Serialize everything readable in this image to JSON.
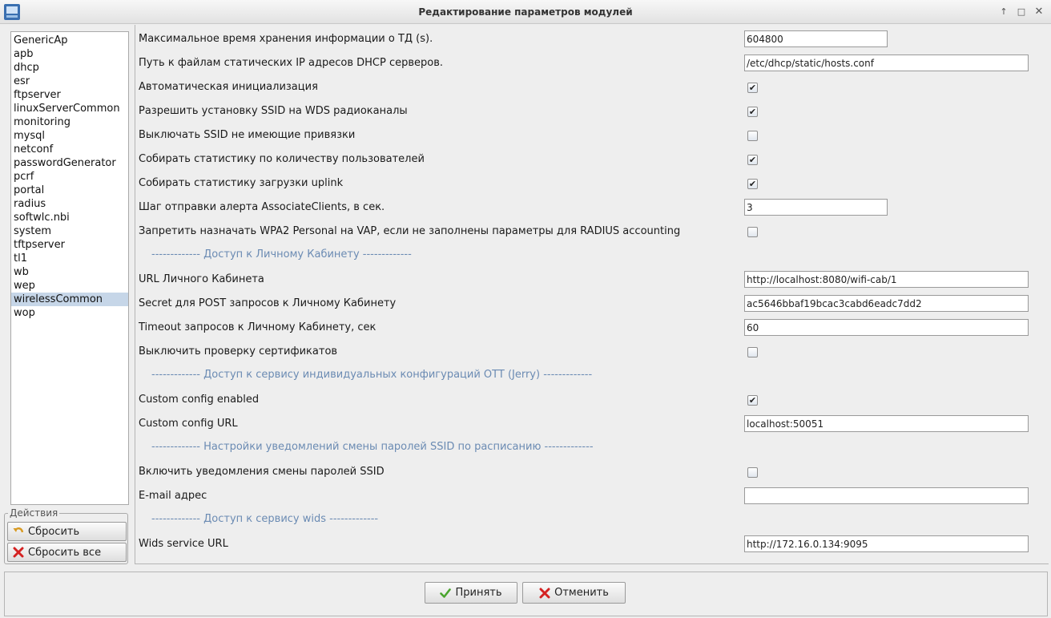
{
  "window": {
    "title": "Редактирование параметров модулей",
    "icon": "app-icon",
    "controls": [
      "minimize-up-icon",
      "maximize-icon",
      "close-icon"
    ]
  },
  "sidebar": {
    "modules": [
      "GenericAp",
      "apb",
      "dhcp",
      "esr",
      "ftpserver",
      "linuxServerCommon",
      "monitoring",
      "mysql",
      "netconf",
      "passwordGenerator",
      "pcrf",
      "portal",
      "radius",
      "softwlc.nbi",
      "system",
      "tftpserver",
      "tl1",
      "wb",
      "wep",
      "wirelessCommon",
      "wop"
    ],
    "selected": "wirelessCommon"
  },
  "actions": {
    "legend": "Действия",
    "reset_label": "Сбросить",
    "reset_all_label": "Сбросить все"
  },
  "settings": {
    "max_time_label": "Максимальное время хранения информации о ТД (s).",
    "max_time_value": "604800",
    "dhcp_path_label": "Путь к файлам статических IP адресов DHCP серверов.",
    "dhcp_path_value": "/etc/dhcp/static/hosts.conf",
    "auto_init_label": "Автоматическая инициализация",
    "auto_init_checked": true,
    "wds_ssid_label": "Разрешить установку SSID на WDS радиоканалы",
    "wds_ssid_checked": true,
    "disable_unbound_ssid_label": "Выключать SSID не имеющие привязки",
    "disable_unbound_ssid_checked": false,
    "stats_users_label": "Собирать статистику по количеству пользователей",
    "stats_users_checked": true,
    "stats_uplink_label": "Собирать статистику загрузки uplink",
    "stats_uplink_checked": true,
    "alert_step_label": "Шаг отправки алерта AssociateClients, в сек.",
    "alert_step_value": "3",
    "forbid_wpa2_label": "Запретить назначать WPA2 Personal на VAP, если не заполнены параметры для RADIUS accounting",
    "forbid_wpa2_checked": false,
    "section_cabinet": "------------- Доступ к Личному Кабинету -------------",
    "cabinet_url_label": "URL Личного Кабинета",
    "cabinet_url_value": "http://localhost:8080/wifi-cab/1",
    "secret_label": "Secret для POST запросов к Личному Кабинету",
    "secret_value": "ac5646bbaf19bcac3cabd6eadc7dd2",
    "timeout_label": "Timeout запросов к Личному Кабинету, сек",
    "timeout_value": "60",
    "disable_cert_label": "Выключить проверку сертификатов",
    "disable_cert_checked": false,
    "section_ott": "------------- Доступ к сервису индивидуальных конфигураций OTT (Jerry) -------------",
    "custom_config_enabled_label": "Custom config enabled",
    "custom_config_enabled_checked": true,
    "custom_config_url_label": "Custom config URL",
    "custom_config_url_value": "localhost:50051",
    "section_notify": "------------- Настройки уведомлений смены паролей SSID по расписанию -------------",
    "notify_label": "Включить уведомления смены паролей SSID",
    "notify_checked": false,
    "email_label": "E-mail адрес",
    "email_value": "",
    "section_wids": "------------- Доступ к сервису wids -------------",
    "wids_url_label": "Wids service URL",
    "wids_url_value": "http://172.16.0.134:9095"
  },
  "footer": {
    "ok_label": "Принять",
    "cancel_label": "Отменить"
  },
  "colors": {
    "selection": "#c6d6e8",
    "section_header": "#6b8bb3",
    "ok_icon": "#4aa52e",
    "cancel_icon": "#d42222"
  }
}
